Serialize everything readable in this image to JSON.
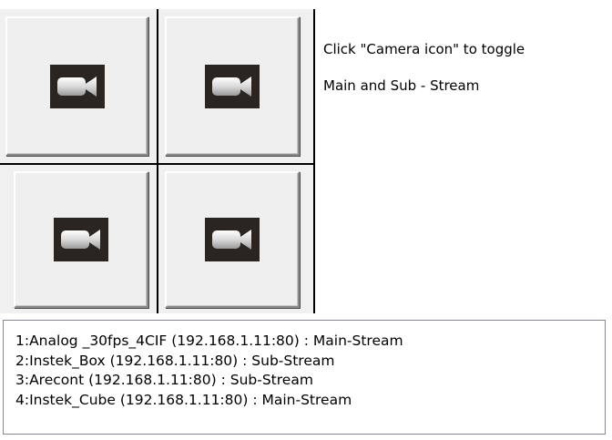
{
  "instruction": {
    "line1": "Click \"Camera icon\" to toggle",
    "line2": "Main and Sub - Stream"
  },
  "camera_tiles": [
    {
      "icon": "video-camera-icon"
    },
    {
      "icon": "video-camera-icon"
    },
    {
      "icon": "video-camera-icon"
    },
    {
      "icon": "video-camera-icon"
    }
  ],
  "stream_list": [
    {
      "text": "1:Analog _30fps_4CIF (192.168.1.11:80) : Main-Stream"
    },
    {
      "text": "2:Instek_Box (192.168.1.11:80) : Sub-Stream"
    },
    {
      "text": "3:Arecont (192.168.1.11:80) : Sub-Stream"
    },
    {
      "text": "4:Instek_Cube (192.168.1.11:80) : Main-Stream"
    }
  ],
  "colors": {
    "tile_background": "#efefef",
    "icon_background": "#2b2522",
    "grid_line": "#000000"
  }
}
